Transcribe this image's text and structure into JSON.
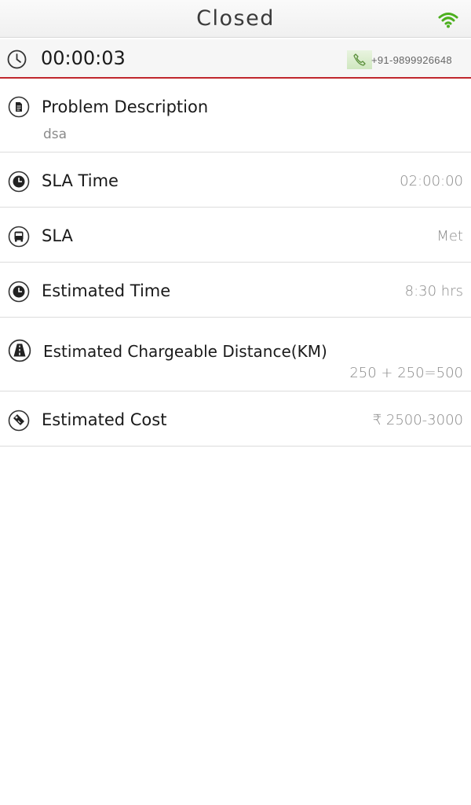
{
  "header": {
    "title": "Closed",
    "wifi_icon": "wifi-icon",
    "wifi_color": "#4caf1e"
  },
  "timer_bar": {
    "clock_icon": "clock-icon",
    "elapsed": "00:00:03",
    "phone_icon": "phone-icon",
    "phone_number": "+91-9899926648",
    "accent_color": "#c0272d"
  },
  "details": {
    "problem_description": {
      "icon": "document-icon",
      "label": "Problem Description",
      "value": "dsa"
    },
    "sla_time": {
      "icon": "timer-icon",
      "label": "SLA Time",
      "value": "02:00:00"
    },
    "sla": {
      "icon": "bus-icon",
      "label": "SLA",
      "value": "Met"
    },
    "estimated_time": {
      "icon": "timer-icon",
      "label": "Estimated Time",
      "value": "8:30 hrs"
    },
    "estimated_distance": {
      "icon": "road-icon",
      "label": "Estimated Chargeable Distance(KM)",
      "value": "250 + 250=500"
    },
    "estimated_cost": {
      "icon": "price-tag-icon",
      "label": "Estimated Cost",
      "value": "₹ 2500-3000"
    }
  }
}
